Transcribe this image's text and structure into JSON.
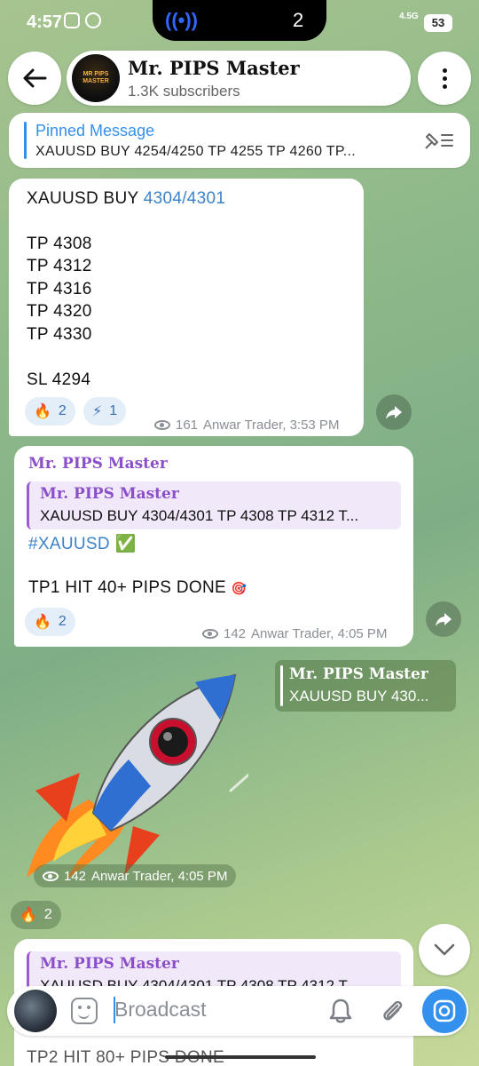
{
  "status_bar": {
    "time": "4:57",
    "island_count": "2",
    "network": "4.5G",
    "battery": "53"
  },
  "header": {
    "channel_name": "Mr. PIPS Master",
    "subscribers": "1.3K subscribers",
    "avatar_text": "MR PIPS MASTER"
  },
  "pinned": {
    "title": "Pinned Message",
    "text": "XAUUSD BUY 4254/4250  TP 4255 TP 4260 TP..."
  },
  "message1": {
    "line1_prefix": "XAUUSD BUY ",
    "line1_link": "4304/4301",
    "tp1": "TP 4308",
    "tp2": "TP 4312",
    "tp3": "TP 4316",
    "tp4": "TP 4320",
    "tp5": "TP 4330",
    "sl": "SL 4294",
    "reaction1_emoji": "🔥",
    "reaction1_count": "2",
    "reaction2_emoji": "⚡",
    "reaction2_count": "1",
    "views": "161",
    "author_time": "Anwar Trader, 3:53 PM"
  },
  "message2": {
    "sender": "Mr. PIPS Master",
    "quote_name": "Mr. PIPS Master",
    "quote_text": "XAUUSD BUY 4304/4301  TP 4308 TP 4312 T...",
    "hashtag": "#XAUUSD",
    "check": "✅",
    "body": "TP1 HIT 40+ PIPS DONE",
    "badge": "🎯",
    "reaction_emoji": "🔥",
    "reaction_count": "2",
    "views": "142",
    "author_time": "Anwar Trader, 4:05 PM"
  },
  "sticker_message": {
    "reply_name": "Mr. PIPS Master",
    "reply_text": "XAUUSD BUY 430...",
    "views": "142",
    "author_time": "Anwar Trader, 4:05 PM",
    "reaction_emoji": "🔥",
    "reaction_count": "2"
  },
  "message3": {
    "quote_name": "Mr. PIPS Master",
    "quote_text": "XAUUSD BUY 4304/4301  TP 4308 TP 4312 T...",
    "tail_text": "TP2 HIT 80+ PIPS DONE"
  },
  "input": {
    "placeholder": "Broadcast"
  },
  "colors": {
    "accent": "#3390ec",
    "sender": "#8b4fc9",
    "link": "#3a83c9"
  }
}
